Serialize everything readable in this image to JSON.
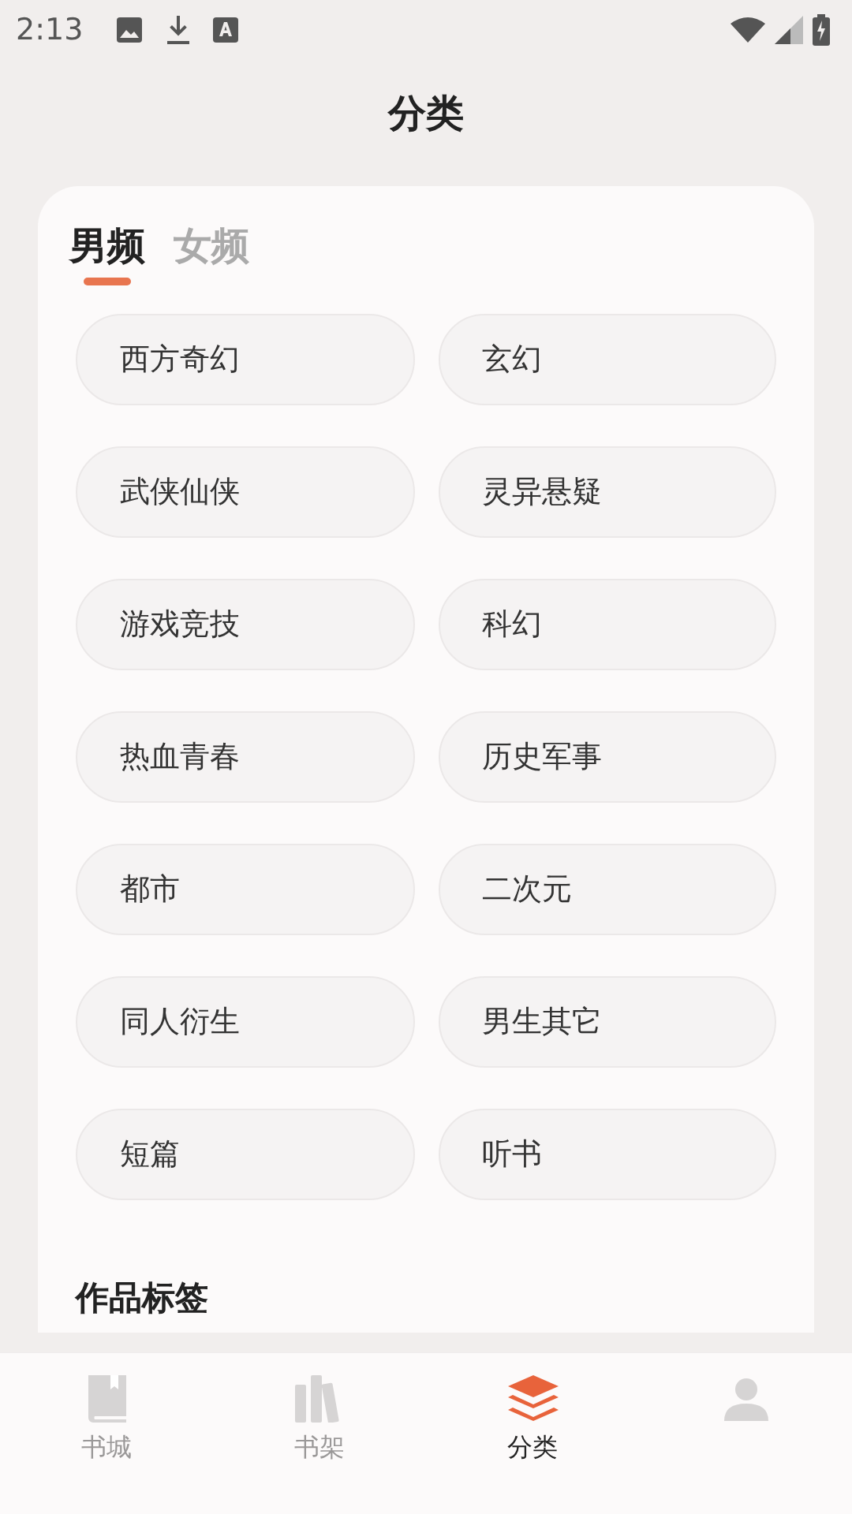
{
  "status_bar": {
    "time": "2:13"
  },
  "title": "分类",
  "gender_tabs": [
    {
      "label": "男频",
      "selected": true
    },
    {
      "label": "女频",
      "selected": false
    }
  ],
  "categories": [
    {
      "label": "西方奇幻"
    },
    {
      "label": "玄幻"
    },
    {
      "label": "武侠仙侠"
    },
    {
      "label": "灵异悬疑"
    },
    {
      "label": "游戏竞技"
    },
    {
      "label": "科幻"
    },
    {
      "label": "热血青春"
    },
    {
      "label": "历史军事"
    },
    {
      "label": "都市"
    },
    {
      "label": "二次元"
    },
    {
      "label": "同人衍生"
    },
    {
      "label": "男生其它"
    },
    {
      "label": "短篇"
    },
    {
      "label": "听书"
    }
  ],
  "tags_heading": "作品标签",
  "bottom_nav": [
    {
      "kind": "book",
      "label": "书城",
      "selected": false
    },
    {
      "kind": "shelf",
      "label": "书架",
      "selected": false
    },
    {
      "kind": "layers",
      "label": "分类",
      "selected": true
    },
    {
      "kind": "person",
      "selected": false
    }
  ]
}
